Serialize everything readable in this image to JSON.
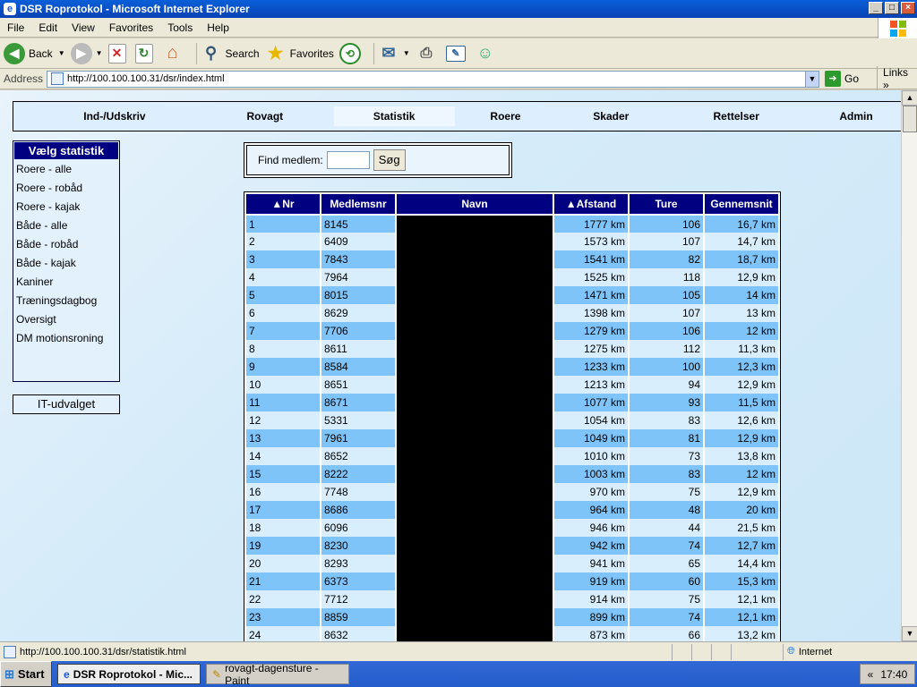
{
  "window": {
    "title": "DSR Roprotokol - Microsoft Internet Explorer"
  },
  "menu": [
    "File",
    "Edit",
    "View",
    "Favorites",
    "Tools",
    "Help"
  ],
  "toolbar": {
    "back": "Back",
    "search": "Search",
    "favorites": "Favorites"
  },
  "address": {
    "label": "Address",
    "url": "http://100.100.100.31/dsr/index.html",
    "go": "Go",
    "links": "Links"
  },
  "nav": [
    "Ind-/Udskriv",
    "Rovagt",
    "Statistik",
    "Roere",
    "Skader",
    "Rettelser",
    "Admin"
  ],
  "nav_active": "Statistik",
  "left_menu": {
    "heading": "Vælg statistik",
    "items": [
      "Roere - alle",
      "Roere - robåd",
      "Roere - kajak",
      "Både - alle",
      "Både - robåd",
      "Både - kajak",
      "Kaniner",
      "Træningsdagbog",
      "Oversigt",
      "DM motionsroning"
    ]
  },
  "it_link": "IT-udvalget",
  "find": {
    "label": "Find medlem:",
    "value": "",
    "button": "Søg"
  },
  "table": {
    "headers": [
      "▲Nr",
      "Medlemsnr",
      "Navn",
      "▲Afstand",
      "Ture",
      "Gennemsnit"
    ],
    "rows": [
      [
        "1",
        "8145",
        "",
        "1777 km",
        "106",
        "16,7 km"
      ],
      [
        "2",
        "6409",
        "",
        "1573 km",
        "107",
        "14,7 km"
      ],
      [
        "3",
        "7843",
        "",
        "1541 km",
        "82",
        "18,7 km"
      ],
      [
        "4",
        "7964",
        "",
        "1525 km",
        "118",
        "12,9 km"
      ],
      [
        "5",
        "8015",
        "",
        "1471 km",
        "105",
        "14 km"
      ],
      [
        "6",
        "8629",
        "",
        "1398 km",
        "107",
        "13 km"
      ],
      [
        "7",
        "7706",
        "",
        "1279 km",
        "106",
        "12 km"
      ],
      [
        "8",
        "8611",
        "",
        "1275 km",
        "112",
        "11,3 km"
      ],
      [
        "9",
        "8584",
        "",
        "1233 km",
        "100",
        "12,3 km"
      ],
      [
        "10",
        "8651",
        "",
        "1213 km",
        "94",
        "12,9 km"
      ],
      [
        "11",
        "8671",
        "",
        "1077 km",
        "93",
        "11,5 km"
      ],
      [
        "12",
        "5331",
        "",
        "1054 km",
        "83",
        "12,6 km"
      ],
      [
        "13",
        "7961",
        "",
        "1049 km",
        "81",
        "12,9 km"
      ],
      [
        "14",
        "8652",
        "",
        "1010 km",
        "73",
        "13,8 km"
      ],
      [
        "15",
        "8222",
        "",
        "1003 km",
        "83",
        "12 km"
      ],
      [
        "16",
        "7748",
        "",
        "970 km",
        "75",
        "12,9 km"
      ],
      [
        "17",
        "8686",
        "",
        "964 km",
        "48",
        "20 km"
      ],
      [
        "18",
        "6096",
        "",
        "946 km",
        "44",
        "21,5 km"
      ],
      [
        "19",
        "8230",
        "",
        "942 km",
        "74",
        "12,7 km"
      ],
      [
        "20",
        "8293",
        "",
        "941 km",
        "65",
        "14,4 km"
      ],
      [
        "21",
        "6373",
        "",
        "919 km",
        "60",
        "15,3 km"
      ],
      [
        "22",
        "7712",
        "",
        "914 km",
        "75",
        "12,1 km"
      ],
      [
        "23",
        "8859",
        "",
        "899 km",
        "74",
        "12,1 km"
      ],
      [
        "24",
        "8632",
        "",
        "873 km",
        "66",
        "13,2 km"
      ]
    ]
  },
  "status": {
    "url": "http://100.100.100.31/dsr/statistik.html",
    "zone": "Internet"
  },
  "taskbar": {
    "start": "Start",
    "tasks": [
      "DSR Roprotokol - Mic...",
      "rovagt-dagensture - Paint"
    ],
    "clock": "17:40"
  }
}
